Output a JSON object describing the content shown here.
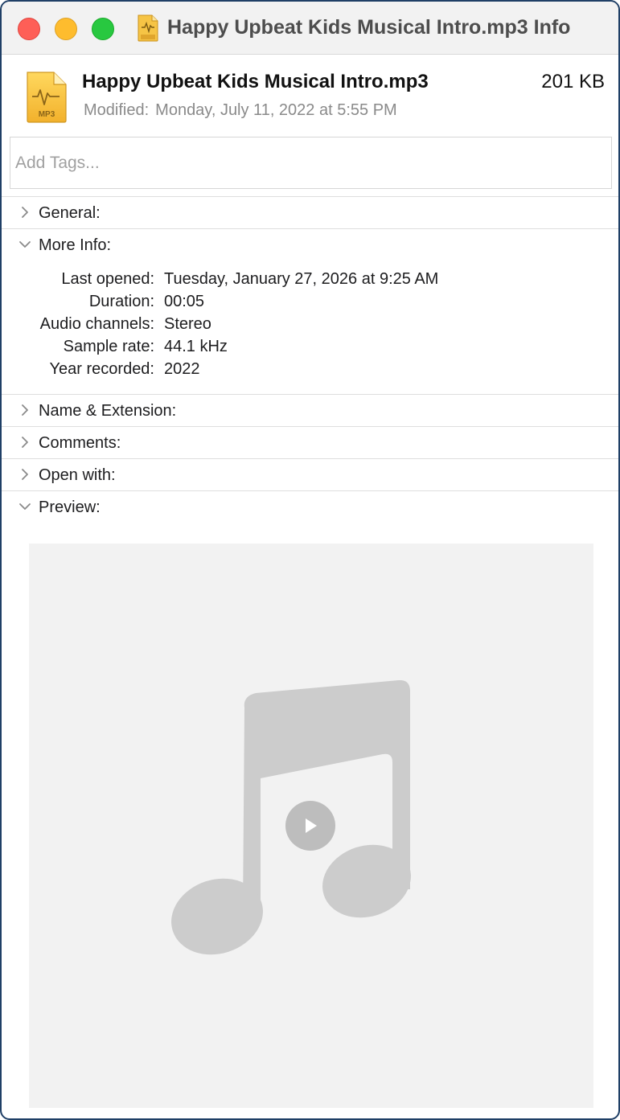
{
  "window": {
    "title": "Happy Upbeat Kids Musical Intro.mp3 Info"
  },
  "file": {
    "name": "Happy Upbeat Kids Musical Intro.mp3",
    "size": "201 KB",
    "modified_label": "Modified:",
    "modified_value": "Monday, July 11, 2022 at 5:55 PM",
    "icon": "mp3-file-icon",
    "icon_badge": "MP3"
  },
  "tags": {
    "placeholder": "Add Tags..."
  },
  "sections": {
    "general": {
      "label": "General:",
      "expanded": false
    },
    "more_info": {
      "label": "More Info:",
      "expanded": true
    },
    "name_extension": {
      "label": "Name & Extension:",
      "expanded": false
    },
    "comments": {
      "label": "Comments:",
      "expanded": false
    },
    "open_with": {
      "label": "Open with:",
      "expanded": false
    },
    "preview": {
      "label": "Preview:",
      "expanded": true
    }
  },
  "more_info": {
    "rows": [
      {
        "label": "Last opened:",
        "value": "Tuesday, January 27, 2026 at 9:25 AM"
      },
      {
        "label": "Duration:",
        "value": "00:05"
      },
      {
        "label": "Audio channels:",
        "value": "Stereo"
      },
      {
        "label": "Sample rate:",
        "value": "44.1 kHz"
      },
      {
        "label": "Year recorded:",
        "value": "2022"
      }
    ]
  },
  "preview": {
    "icon": "music-note-icon",
    "play_icon": "play-icon"
  },
  "colors": {
    "close": "#fe5f57",
    "minimize": "#febc2e",
    "maximize": "#28c840",
    "preview_bg": "#f2f2f2",
    "note": "#cccccc"
  }
}
